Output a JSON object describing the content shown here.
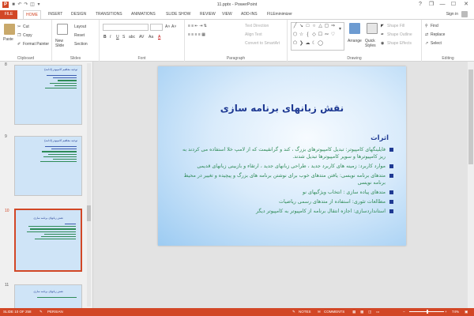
{
  "window": {
    "title": "11.pptx - PowerPoint",
    "app_icon": "P",
    "help": "?",
    "controls": [
      "❐",
      "—",
      "☐",
      "✕"
    ]
  },
  "menu": {
    "file": "FILE",
    "tabs": [
      "HOME",
      "INSERT",
      "DESIGN",
      "TRANSITIONS",
      "ANIMATIONS",
      "SLIDE SHOW",
      "REVIEW",
      "VIEW",
      "ADD-INS",
      "FILEminimizer"
    ],
    "active_tab": "HOME",
    "sign_in": "Sign in"
  },
  "ribbon": {
    "clipboard": {
      "label": "Clipboard",
      "paste": "Paste",
      "cut": "Cut",
      "copy": "Copy",
      "format_painter": "Format Painter"
    },
    "slides": {
      "label": "Slides",
      "new_slide": "New Slide",
      "layout": "Layout",
      "reset": "Reset",
      "section": "Section"
    },
    "font": {
      "label": "Font",
      "bold": "B",
      "italic": "I",
      "underline": "U",
      "strike": "S",
      "shadow": "abc",
      "spacing": "AV",
      "case": "Aa",
      "color": "A",
      "grow": "A˄",
      "shrink": "A˅"
    },
    "paragraph": {
      "label": "Paragraph",
      "text_direction": "Text Direction",
      "align_text": "Align Text",
      "convert_smartart": "Convert to SmartArt"
    },
    "drawing": {
      "label": "Drawing",
      "arrange": "Arrange",
      "quick_styles": "Quick Styles",
      "shape_fill": "Shape Fill",
      "shape_outline": "Shape Outline",
      "shape_effects": "Shape Effects"
    },
    "editing": {
      "label": "Editing",
      "find": "Find",
      "replace": "Replace",
      "select": "Select"
    }
  },
  "thumbnails": [
    {
      "number": "8",
      "title": "توجیه مفاهیم کامپیوتر (ادامه)",
      "active": false
    },
    {
      "number": "9",
      "title": "توجیه مفاهیم کامپیوتر (ادامه)",
      "active": false
    },
    {
      "number": "10",
      "title": "نقش زبانهای برنامه سازی",
      "active": true
    },
    {
      "number": "11",
      "title": "نقش زبانهای برنامه سازی",
      "active": false
    }
  ],
  "slide": {
    "title": "نقش زبانهای برنامه سازی",
    "heading": "اثرات",
    "bullets": [
      "فایلینگهای کامپیوتر: تبدیل کامپیوترهای بزرگ ، کند و گرانقیمت که از لامپ خلا استفاده می کردند به ریز کامپیوترها و سوپر کامپیوترها تبدیل شدند.",
      "موارد کاربرد: زمینه های کاربرد جدید ، طراحی زبانهای جدید ، ارتقاء و بازبینی زبانهای قدیمی",
      "متدهای برنامه نویسی: یافتن متدهای خوب برای نوشتن برنامه های بزرگ و پیچیده و تغییر در محیط برنامه نویسی",
      "متدهای پیاده سازی : انتخاب ویژگیهای نو",
      "مطالعات تئوری: استفاده از متدهای رسمی ریاضیات",
      "استانداردسازی: اجازه انتقال برنامه از کامپیوتر به کامپیوتر دیگر"
    ]
  },
  "status": {
    "slide_info": "SLIDE 10 OF 258",
    "language": "PERSIAN",
    "notes": "NOTES",
    "comments": "COMMENTS",
    "zoom": "74%"
  },
  "colors": {
    "accent": "#d24726",
    "title_blue": "#1f3a93",
    "bullet_green": "#2e8b57"
  }
}
